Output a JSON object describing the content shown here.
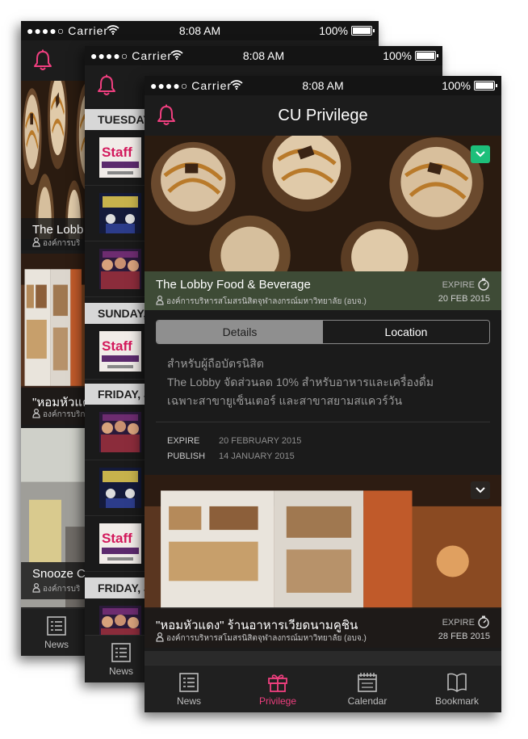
{
  "status": {
    "carrier": "Carrier",
    "time": "8:08 AM",
    "battery": "100%"
  },
  "app_title": "CU Privilege",
  "tabs": [
    {
      "label": "News",
      "icon": "news-icon"
    },
    {
      "label": "Privilege",
      "icon": "gift-icon"
    },
    {
      "label": "Calendar",
      "icon": "calendar-icon"
    },
    {
      "label": "Bookmark",
      "icon": "bookmark-icon"
    }
  ],
  "active_tab": "Privilege",
  "back_screen": {
    "items": [
      {
        "title": "The Lobb",
        "sub": "องค์การบริ"
      },
      {
        "title": "\"หอมหัวแด",
        "sub": "องค์การบริก"
      },
      {
        "title": "Snooze C",
        "sub": "องค์การบริ"
      }
    ]
  },
  "mid_screen": {
    "day_headers": [
      "TUESDAY",
      "SUNDAY,",
      "FRIDAY, J",
      "FRIDAY, J"
    ]
  },
  "front_screen": {
    "featured": {
      "title": "The Lobby Food & Beverage",
      "org": "องค์การบริหารสโมสรนิสิตจุฬาลงกรณ์มหาวิทยาลัย (อบจ.)",
      "expire_label": "EXPIRE",
      "expire_date": "20 FEB 2015"
    },
    "segment": {
      "details": "Details",
      "location": "Location",
      "selected": "Details"
    },
    "description": [
      "สำหรับผู้ถือบัตรนิสิต",
      "The Lobby จัดส่วนลด 10% สำหรับอาหารและเครื่องดื่ม",
      "เฉพาะสาขายูเซ็นเตอร์ และสาขาสยามสแควร์วัน"
    ],
    "meta": {
      "expire_key": "EXPIRE",
      "expire_val": "20 FEBRUARY 2015",
      "publish_key": "PUBLISH",
      "publish_val": "14 JANUARY 2015"
    },
    "second": {
      "title": "\"หอมหัวแดง\" ร้านอาหารเวียดนามคูชิน",
      "org": "องค์การบริหารสโมสรนิสิตจุฬาลงกรณ์มหาวิทยาลัย (อบจ.)",
      "expire_label": "EXPIRE",
      "expire_date": "28 FEB 2015"
    }
  },
  "colors": {
    "accent": "#ef3f7f",
    "check": "#1dbf7a",
    "background": "#1b1b1b"
  }
}
